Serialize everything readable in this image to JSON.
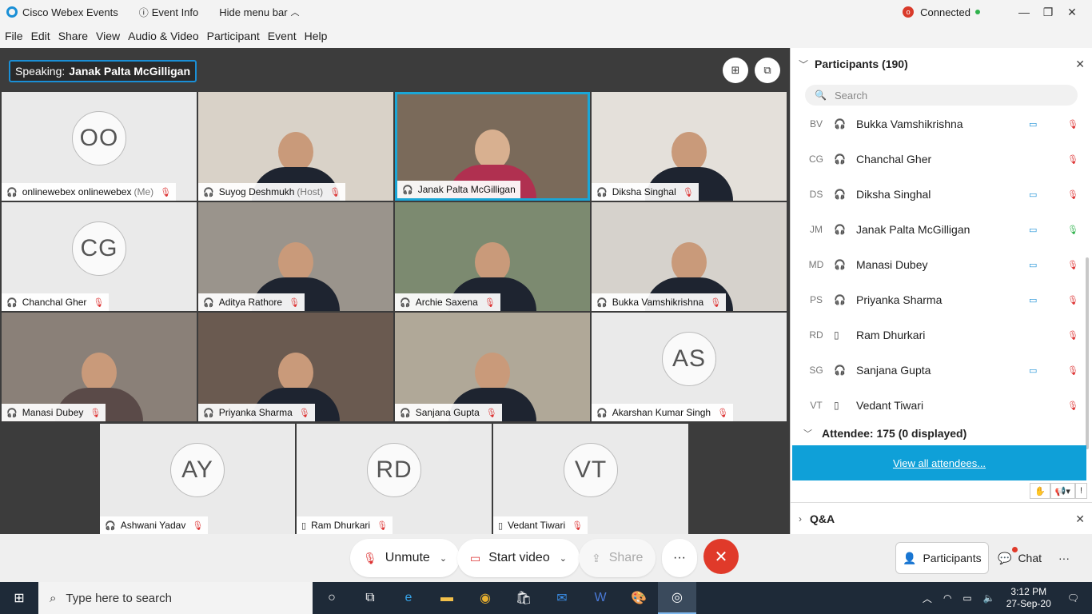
{
  "titlebar": {
    "app_name": "Cisco Webex Events",
    "event_info": "Event Info",
    "hide_menu": "Hide menu bar",
    "status": "Connected"
  },
  "menubar": [
    "File",
    "Edit",
    "Share",
    "View",
    "Audio & Video",
    "Participant",
    "Event",
    "Help"
  ],
  "stage": {
    "speaking_label": "Speaking:",
    "speaking_name": "Janak Palta McGilligan",
    "tiles": [
      {
        "name": "onlinewebex onlinewebex",
        "suffix": "(Me)",
        "initials": "OO"
      },
      {
        "name": "Suyog Deshmukh",
        "suffix": "(Host)"
      },
      {
        "name": "Janak Palta McGilligan",
        "suffix": ""
      },
      {
        "name": "Diksha Singhal",
        "suffix": ""
      },
      {
        "name": "Chanchal Gher",
        "suffix": "",
        "initials": "CG"
      },
      {
        "name": "Aditya Rathore",
        "suffix": ""
      },
      {
        "name": "Archie Saxena",
        "suffix": ""
      },
      {
        "name": "Bukka Vamshikrishna",
        "suffix": ""
      },
      {
        "name": "Manasi Dubey",
        "suffix": ""
      },
      {
        "name": "Priyanka Sharma",
        "suffix": ""
      },
      {
        "name": "Sanjana Gupta",
        "suffix": ""
      },
      {
        "name": "Akarshan Kumar Singh",
        "suffix": "",
        "initials": "AS"
      },
      {
        "name": "Ashwani Yadav",
        "suffix": "",
        "initials": "AY"
      },
      {
        "name": "Ram Dhurkari",
        "suffix": "",
        "initials": "RD"
      },
      {
        "name": "Vedant Tiwari",
        "suffix": "",
        "initials": "VT"
      }
    ]
  },
  "panel": {
    "participants_title": "Participants (190)",
    "search_placeholder": "Search",
    "participants": [
      {
        "initials": "BV",
        "name": "Bukka Vamshikrishna"
      },
      {
        "initials": "CG",
        "name": "Chanchal Gher"
      },
      {
        "initials": "DS",
        "name": "Diksha Singhal"
      },
      {
        "initials": "JM",
        "name": "Janak Palta McGilligan"
      },
      {
        "initials": "MD",
        "name": "Manasi Dubey"
      },
      {
        "initials": "PS",
        "name": "Priyanka Sharma"
      },
      {
        "initials": "RD",
        "name": "Ram Dhurkari"
      },
      {
        "initials": "SG",
        "name": "Sanjana Gupta"
      },
      {
        "initials": "VT",
        "name": "Vedant Tiwari"
      }
    ],
    "attendee_label": "Attendee: 175 (0 displayed)",
    "view_all": "View all attendees...",
    "qa_title": "Q&A"
  },
  "controls": {
    "unmute": "Unmute",
    "start_video": "Start video",
    "share": "Share",
    "participants": "Participants",
    "chat": "Chat"
  },
  "taskbar": {
    "search_placeholder": "Type here to search",
    "time": "3:12 PM",
    "date": "27-Sep-20"
  },
  "colors": {
    "accent": "#1a8fd6",
    "end_call": "#e03a2a",
    "view_all_bg": "#0fa0d8",
    "mic_muted": "#dd3333",
    "connected": "#2fb24c"
  }
}
